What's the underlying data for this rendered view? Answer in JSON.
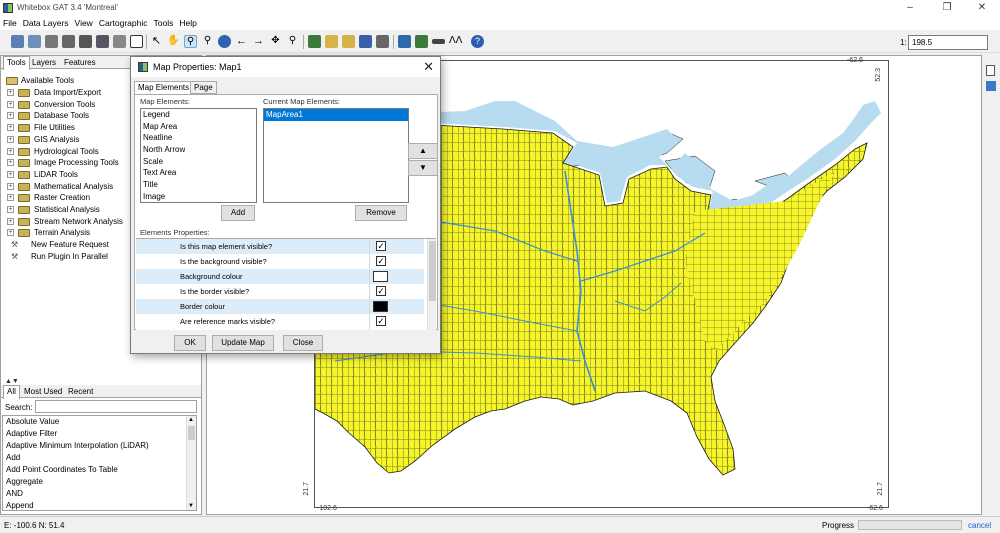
{
  "window": {
    "title": "Whitebox GAT 3.4 'Montreal'",
    "minimize_icon": "minimize-icon",
    "restore_icon": "restore-icon",
    "close_icon": "close-icon"
  },
  "menu": [
    "File",
    "Data Layers",
    "View",
    "Cartographic",
    "Tools",
    "Help"
  ],
  "toolbar": {
    "scale_label": "1:",
    "scale_value": "198.5",
    "icons": [
      "open-raster-icon",
      "open-vector-icon",
      "save-icon",
      "save-as-icon",
      "close-layer-icon",
      "print-icon",
      "layer-properties-icon",
      "table-icon",
      "select-icon",
      "pan-icon",
      "zoom-in-icon",
      "zoom-out-icon",
      "full-extent-icon",
      "previous-extent-icon",
      "next-extent-icon",
      "select-features-icon",
      "zoom-to-layer-icon",
      "map-book-icon",
      "open-folder-icon",
      "new-folder-icon",
      "save-map-icon",
      "print-map-icon",
      "raster-calculator-icon",
      "table-view-icon",
      "ruler-icon",
      "digitize-icon",
      "help-icon"
    ]
  },
  "left_panel": {
    "tabs": [
      "Tools",
      "Layers",
      "Features"
    ],
    "tree_root": "Available Tools",
    "categories": [
      "Data Import/Export",
      "Conversion Tools",
      "Database Tools",
      "File Utilities",
      "GIS Analysis",
      "Hydrological Tools",
      "Image Processing Tools",
      "LiDAR Tools",
      "Mathematical Analysis",
      "Raster Creation",
      "Statistical Analysis",
      "Stream Network Analysis",
      "Terrain Analysis"
    ],
    "extra_items": [
      "New Feature Request",
      "Run Plugin In Parallel"
    ],
    "bottom_tabs": [
      "All",
      "Most Used",
      "Recent"
    ],
    "search_label": "Search:",
    "search_value": "",
    "tool_list": [
      "Absolute Value",
      "Adaptive Filter",
      "Adaptive Minimum Interpolation (LiDAR)",
      "Add",
      "Add Point Coordinates To Table",
      "Aggregate",
      "AND",
      "Append"
    ]
  },
  "map": {
    "coords": {
      "top_right": "-62.6",
      "right_top": "52.3",
      "left_bottom": "21.7",
      "bottom_left": "-102.6",
      "bottom_right": "-62.6",
      "right_bottom": "21.7"
    },
    "land_color": "#f5f52a",
    "water_color": "#b7dcef",
    "border_color": "#1a1a1a"
  },
  "status": {
    "coords": "E: -100.6  N: 51.4",
    "progress_label": "Progress",
    "progress_value": 0,
    "cancel": "cancel"
  },
  "dialog": {
    "title": "Map Properties: Map1",
    "tabs": [
      "Map Elements",
      "Page"
    ],
    "map_elements_label": "Map Elements:",
    "map_elements": [
      "Legend",
      "Map Area",
      "Neatline",
      "North Arrow",
      "Scale",
      "Text Area",
      "Title",
      "Image"
    ],
    "current_label": "Current Map Elements:",
    "current_elements": [
      "MapArea1"
    ],
    "add_button": "Add",
    "remove_button": "Remove",
    "up_button": "▲",
    "down_button": "▼",
    "props_label": "Elements Properties:",
    "properties": [
      {
        "name": "Is this map element visible?",
        "type": "checkbox",
        "value": "✓"
      },
      {
        "name": "Is the background visible?",
        "type": "checkbox",
        "value": "✓"
      },
      {
        "name": "Background colour",
        "type": "color",
        "value": "#ffffff"
      },
      {
        "name": "Is the border visible?",
        "type": "checkbox",
        "value": "✓"
      },
      {
        "name": "Border colour",
        "type": "color",
        "value": "#000000"
      },
      {
        "name": "Are reference marks visible?",
        "type": "checkbox",
        "value": "✓"
      }
    ],
    "ok_button": "OK",
    "update_button": "Update Map",
    "close_button": "Close"
  }
}
